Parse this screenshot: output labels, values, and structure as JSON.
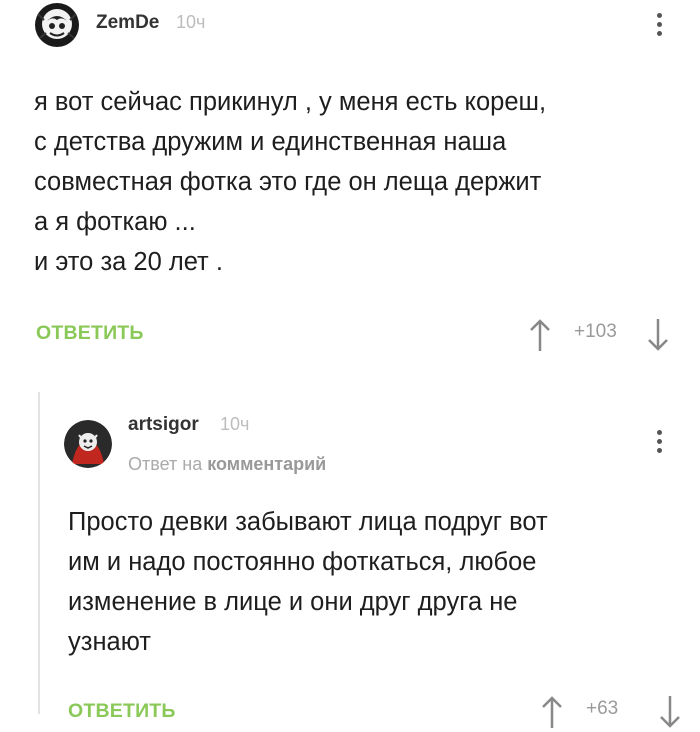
{
  "comments": [
    {
      "author": "ZemDe",
      "time": "10ч",
      "lines": [
        "я вот сейчас прикинул , у меня есть кореш,",
        "с детства дружим и единственная наша",
        "совместная фотка это где он леща держит",
        "а я фоткаю ...",
        "и это за 20 лет ."
      ],
      "reply_label": "ОТВЕТИТЬ",
      "rating": "+103"
    },
    {
      "author": "artsigor",
      "time": "10ч",
      "reply_to_prefix": "Ответ на",
      "reply_to_target": "комментарий",
      "lines": [
        "Просто девки забывают лица подруг вот",
        "им и надо постоянно фоткаться, любое",
        "изменение в лице и они друг друга не",
        "узнают"
      ],
      "reply_label": "ОТВЕТИТЬ",
      "rating": "+63"
    }
  ],
  "colors": {
    "accent_green": "#8ac858",
    "muted_text": "#bdbdbd",
    "thread_line": "#e2e2e2"
  },
  "icons": [
    "avatar-zemde",
    "avatar-artsigor",
    "more-vertical-icon",
    "vote-up-icon",
    "vote-down-icon"
  ]
}
